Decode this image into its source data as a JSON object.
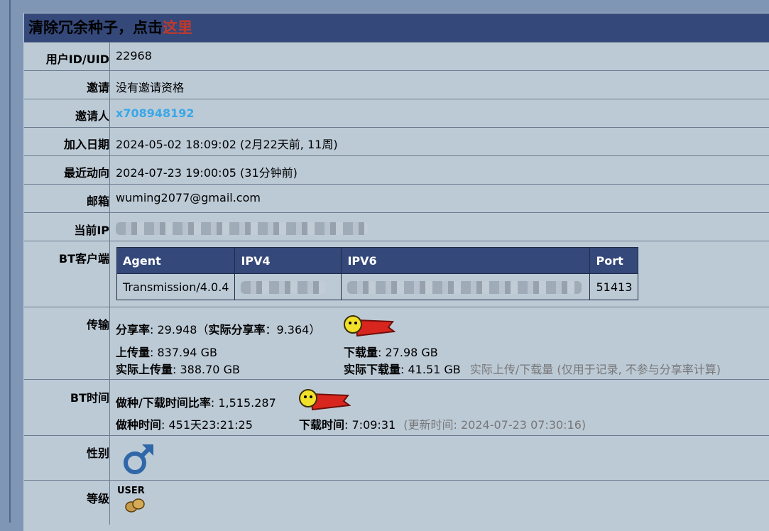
{
  "banner": {
    "prefix": "清除冗余种子，点击",
    "link": "这里"
  },
  "uid": {
    "label": "用户ID/UID",
    "value": "22968"
  },
  "invite": {
    "label": "邀请",
    "value": "没有邀请资格"
  },
  "inviter": {
    "label": "邀请人",
    "value": "x708948192"
  },
  "joined": {
    "label": "加入日期",
    "value": "2024-05-02 18:09:02 (2月22天前, 11周)"
  },
  "last_seen": {
    "label": "最近动向",
    "value": "2024-07-23 19:00:05 (31分钟前)"
  },
  "email": {
    "label": "邮箱",
    "value": "wuming2077@gmail.com"
  },
  "ip": {
    "label": "当前IP"
  },
  "bt_client": {
    "label": "BT客户端",
    "headers": [
      "Agent",
      "IPV4",
      "IPV6",
      "Port"
    ],
    "agent": "Transmission/4.0.4",
    "port": "51413"
  },
  "transfer": {
    "label": "传输",
    "ratio_label": "分享率",
    "ratio": "29.948",
    "real_ratio_label": "实际分享率",
    "real_ratio": "9.364",
    "upload_label": "上传量",
    "upload": "837.94 GB",
    "download_label": "下载量",
    "download": "27.98 GB",
    "real_upload_label": "实际上传量",
    "real_upload": "388.70 GB",
    "real_download_label": "实际下载量",
    "real_download": "41.51 GB",
    "note": "实际上传/下载量 (仅用于记录, 不参与分享率计算)"
  },
  "bt_time": {
    "label": "BT时间",
    "ratio_label": "做种/下载时间比率",
    "ratio": "1,515.287",
    "seed_label": "做种时间",
    "seed": "451天23:21:25",
    "dl_label": "下载时间",
    "dl": "7:09:31",
    "updated": "(更新时间: 2024-07-23 07:30:16)"
  },
  "gender": {
    "label": "性别",
    "icon": "male-symbol-icon"
  },
  "level": {
    "label": "等级",
    "value": "USER",
    "icon": "peanut-icon"
  },
  "colors": {
    "header": "#34487a",
    "panel": "#bccad6",
    "link": "#3aa7e8",
    "highlight": "#c0392b"
  }
}
